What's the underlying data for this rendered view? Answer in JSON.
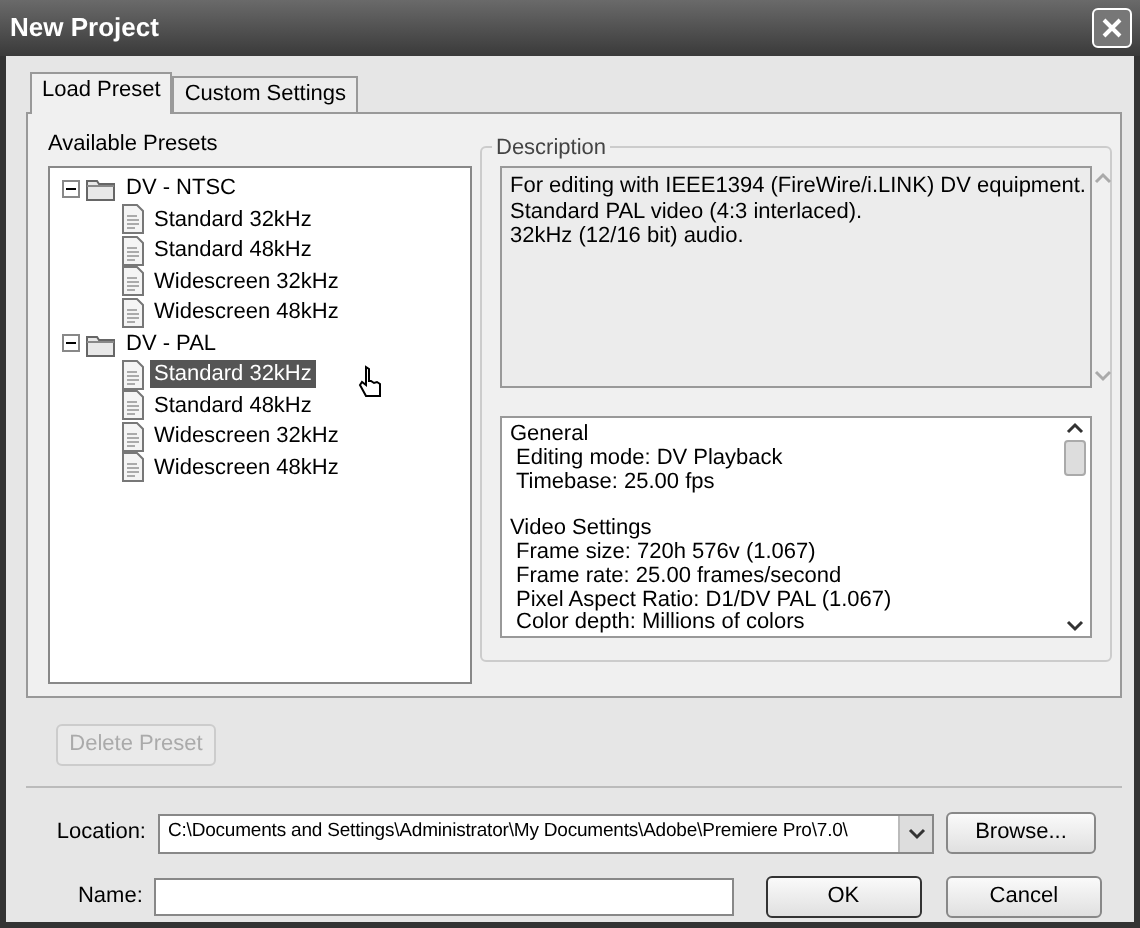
{
  "window": {
    "title": "New Project"
  },
  "tabs": [
    {
      "label": "Load Preset",
      "selected": true
    },
    {
      "label": "Custom Settings",
      "selected": false
    }
  ],
  "presets": {
    "label": "Available Presets",
    "tree": [
      {
        "label": "DV - NTSC",
        "expanded": true,
        "children": [
          {
            "label": "Standard 32kHz",
            "selected": false
          },
          {
            "label": "Standard 48kHz",
            "selected": false
          },
          {
            "label": "Widescreen 32kHz",
            "selected": false
          },
          {
            "label": "Widescreen 48kHz",
            "selected": false
          }
        ]
      },
      {
        "label": "DV - PAL",
        "expanded": true,
        "children": [
          {
            "label": "Standard 32kHz",
            "selected": true
          },
          {
            "label": "Standard 48kHz",
            "selected": false
          },
          {
            "label": "Widescreen 32kHz",
            "selected": false
          },
          {
            "label": "Widescreen 48kHz",
            "selected": false
          }
        ]
      }
    ]
  },
  "description": {
    "label": "Description",
    "lines": [
      "For editing with IEEE1394 (FireWire/i.LINK) DV equipment.",
      "Standard PAL video (4:3 interlaced).",
      "32kHz (12/16 bit) audio."
    ]
  },
  "settings": {
    "sections": [
      {
        "title": "General",
        "lines": [
          "Editing mode: DV Playback",
          "Timebase: 25.00 fps"
        ]
      },
      {
        "title": "Video Settings",
        "lines": [
          "Frame size: 720h 576v (1.067)",
          "Frame rate: 25.00 frames/second",
          "Pixel Aspect Ratio: D1/DV PAL (1.067)",
          "Color depth: Millions of colors"
        ]
      }
    ]
  },
  "delete_button": {
    "label": "Delete Preset",
    "disabled": true
  },
  "location": {
    "label": "Location:",
    "value": "C:\\Documents and Settings\\Administrator\\My Documents\\Adobe\\Premiere Pro\\7.0\\",
    "button": "Browse..."
  },
  "name": {
    "label": "Name:"
  },
  "buttons": [
    "OK",
    "Cancel"
  ]
}
